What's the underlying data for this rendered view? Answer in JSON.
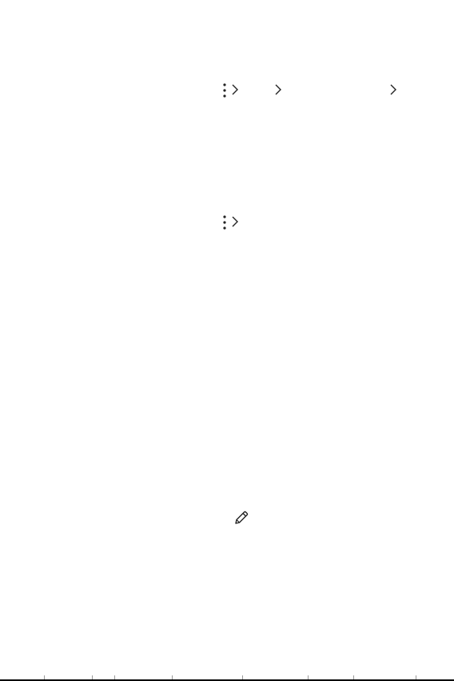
{
  "icons": {
    "row1": [
      "more-vert-icon",
      "chevron-right-icon",
      "chevron-right-icon",
      "chevron-right-icon"
    ],
    "row2": [
      "more-vert-icon",
      "chevron-right-icon"
    ],
    "edit": "pencil-icon"
  },
  "colors": {
    "ink": "#222222",
    "page": "#ffffff",
    "rule": "#000000"
  }
}
